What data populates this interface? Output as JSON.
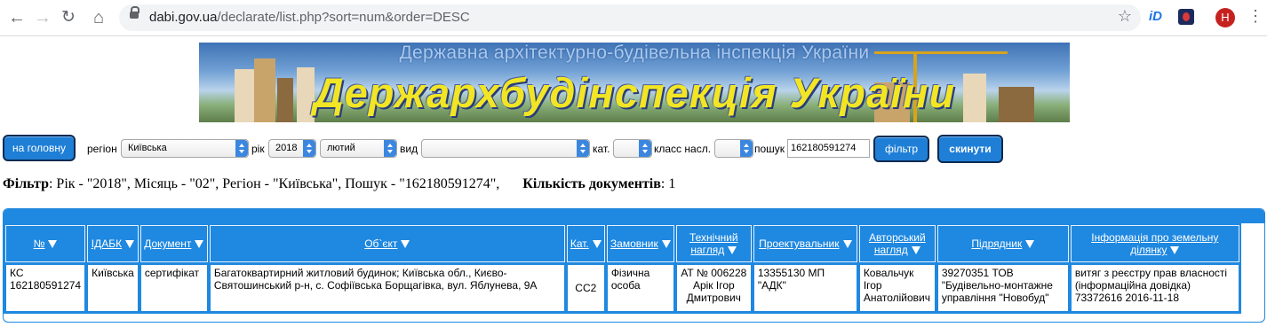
{
  "browser": {
    "url_host": "dabi.gov.ua",
    "url_path": "/declarate/list.php?sort=num&order=DESC",
    "avatar_letter": "H",
    "ext1_label": "iD"
  },
  "banner": {
    "subtitle": "Державна архітектурно-будівельна інспекція України",
    "title": "Держархбудінспекція України"
  },
  "filters": {
    "home_button": "на головну",
    "region_label": "регіон",
    "region_value": "Київська",
    "year_label": "рік",
    "year_value": "2018",
    "month_value": "лютий",
    "type_label": "вид",
    "type_value": "",
    "cat_label": "кат.",
    "cat_value": "",
    "class_label": "класс насл.",
    "class_value": "",
    "search_label": "пошук",
    "search_value": "162180591274",
    "filter_button": "фільтр",
    "reset_button": "скинути"
  },
  "summary": {
    "filter_label": "Фільтр",
    "filter_text": ": Рік - \"2018\", Місяць - \"02\", Регіон - \"Київська\", Пошук - \"162180591274\",",
    "count_label": "Кількість документів",
    "count_value": ": 1"
  },
  "table": {
    "headers": [
      "№",
      "ІДАБК",
      "Документ",
      "Об`єкт",
      "Кат.",
      "Замовник",
      "Технічний нагляд",
      "Проектувальник",
      "Авторський нагляд",
      "Підрядник",
      "Інформація про земельну ділянку"
    ],
    "rows": [
      [
        "КС 162180591274",
        "Київська",
        "сертифікат",
        "Багатоквартирний житловий будинок; Київська обл., Києво-Святошинський р-н, с. Софіївська Борщагівка, вул. Яблунева, 9А",
        "СС2",
        "Фізична особа",
        "АТ № 006228 Арік Ігор Дмитрович",
        "13355130 МП \"АДК\"",
        "Ковальчук Ігор Анатолійович",
        "39270351 ТОВ \"Будівельно-монтажне управління \"Новобуд\"",
        "витяг з реєстру прав власності (інформаційна довідка) 73372616 2016-11-18"
      ]
    ]
  }
}
